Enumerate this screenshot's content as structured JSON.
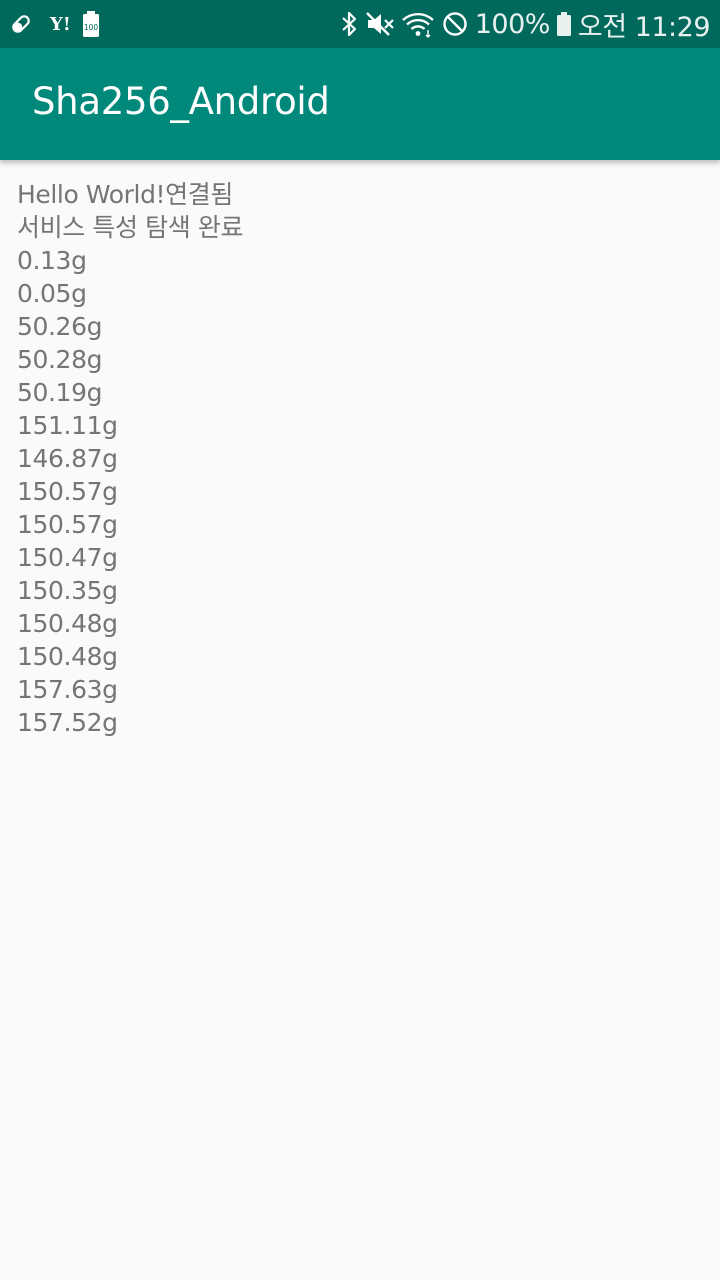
{
  "status_bar": {
    "left_icons": [
      "pill-icon",
      "yahoo-icon",
      "battery-100-notification-icon"
    ],
    "yahoo_text": "Y!",
    "battery_notice_text": "100",
    "right_icons": [
      "bluetooth-icon",
      "mute-icon",
      "wifi-icon",
      "do-not-disturb-icon",
      "battery-icon"
    ],
    "battery_percent": "100%",
    "time": "오전 11:29"
  },
  "app_bar": {
    "title": "Sha256_Android"
  },
  "log": {
    "lines": [
      "Hello World!연결됨",
      "서비스 특성 탐색 완료",
      "0.13g",
      "0.05g",
      "50.26g",
      "50.28g",
      "50.19g",
      "151.11g",
      "146.87g",
      "150.57g",
      "150.57g",
      "150.47g",
      "150.35g",
      "150.48g",
      "150.48g",
      "157.63g",
      "157.52g"
    ]
  },
  "colors": {
    "status_bar": "#00695c",
    "app_bar": "#00897b",
    "background": "#fafafa",
    "text": "#757575"
  }
}
